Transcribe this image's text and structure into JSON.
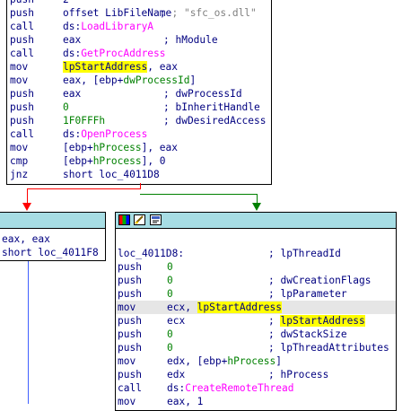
{
  "top_block": {
    "lines": [
      {
        "mn": "push",
        "op": "2"
      },
      {
        "mn": "push",
        "op": "offset LibFileName",
        "cmt": "; \"sfc_os.dll\""
      },
      {
        "mn": "call",
        "op_prefix": "ds:",
        "op_func": "LoadLibraryA"
      },
      {
        "mn": "push",
        "op": "eax",
        "cmt": "; hModule"
      },
      {
        "mn": "call",
        "op_prefix": "ds:",
        "op_func": "GetProcAddress"
      },
      {
        "mn": "mov",
        "op_hl": "lpStartAddress",
        "op_rest": ", eax"
      },
      {
        "mn": "mov",
        "op": "eax, [ebp+",
        "op_var": "dwProcessId",
        "op_end": "]"
      },
      {
        "mn": "push",
        "op": "eax",
        "cmt": "; dwProcessId"
      },
      {
        "mn": "push",
        "op_imm": "0",
        "cmt": "; bInheritHandle"
      },
      {
        "mn": "push",
        "op_imm": "1F0FFFh",
        "cmt": "; dwDesiredAccess"
      },
      {
        "mn": "call",
        "op_prefix": "ds:",
        "op_func": "OpenProcess"
      },
      {
        "mn": "mov",
        "op": "[ebp+",
        "op_var": "hProcess",
        "op_end": "], eax"
      },
      {
        "mn": "cmp",
        "op": "[ebp+",
        "op_var": "hProcess",
        "op_end": "], 0"
      },
      {
        "mn": "jnz",
        "op": "short loc_4011D8"
      }
    ]
  },
  "left_block": {
    "lines": [
      {
        "text": "eax, eax"
      },
      {
        "text": "short loc_4011F8"
      }
    ]
  },
  "right_block": {
    "label": "loc_4011D8:",
    "label_cmt": "; lpThreadId",
    "lines": [
      {
        "mn": "push",
        "op_imm": "0"
      },
      {
        "mn": "push",
        "op_imm": "0",
        "cmt": "; dwCreationFlags"
      },
      {
        "mn": "push",
        "op_imm": "0",
        "cmt": "; lpParameter"
      },
      {
        "mn": "mov",
        "op": "ecx, ",
        "op_hl": "lpStartAddress",
        "highlight_row": true
      },
      {
        "mn": "push",
        "op": "ecx",
        "cmt_hl": "lpStartAddress"
      },
      {
        "mn": "push",
        "op_imm": "0",
        "cmt": "; dwStackSize"
      },
      {
        "mn": "push",
        "op_imm": "0",
        "cmt": "; lpThreadAttributes"
      },
      {
        "mn": "mov",
        "op": "edx, [ebp+",
        "op_var": "hProcess",
        "op_end": "]"
      },
      {
        "mn": "push",
        "op": "edx",
        "cmt": "; hProcess"
      },
      {
        "mn": "call",
        "op_prefix": "ds:",
        "op_func": "CreateRemoteThread"
      },
      {
        "mn": "mov",
        "op": "eax, 1"
      }
    ]
  },
  "colors": {
    "text": "#000080",
    "func": "#ff00ff",
    "imm": "#008000",
    "highlight": "#ffff00",
    "titlebar": "#a7dde4",
    "edge_false": "#ff0000",
    "edge_true": "#008000",
    "edge_blue": "#0000ff"
  },
  "icons": [
    "graph-color-icon",
    "rename-node-icon",
    "graph-overview-icon"
  ]
}
